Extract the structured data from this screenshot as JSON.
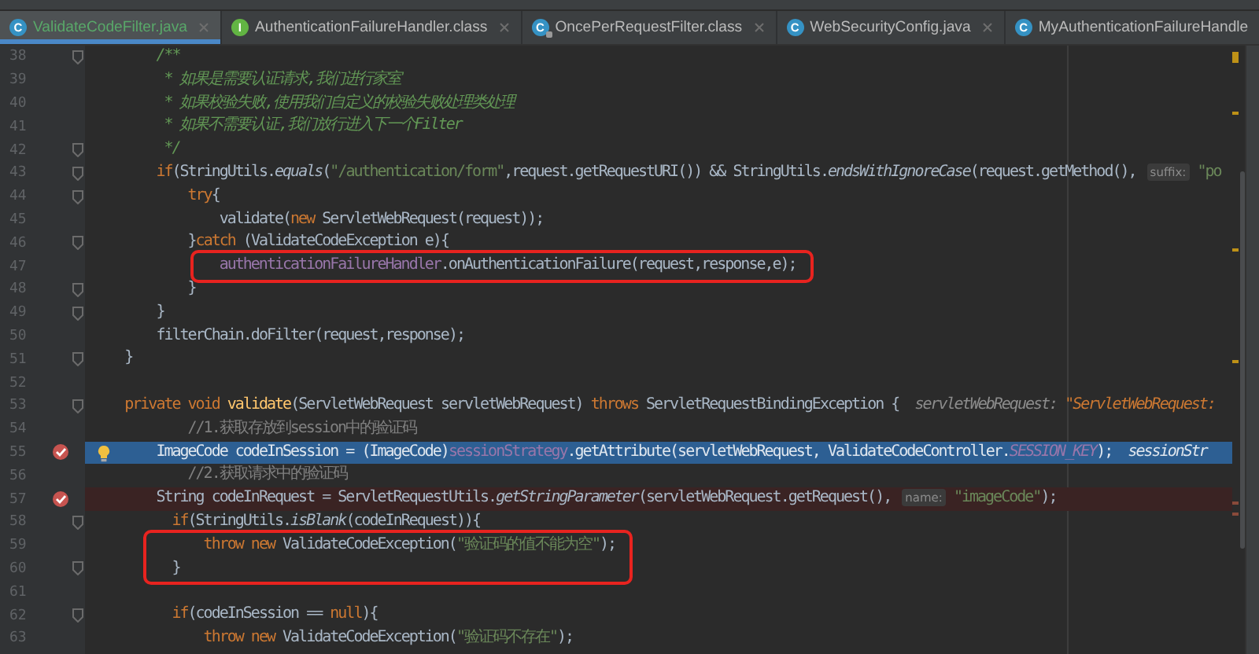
{
  "tabs": [
    {
      "label": "ValidateCodeFilter.java",
      "icon": "C",
      "kind": "class",
      "selected": true,
      "closable": true
    },
    {
      "label": "AuthenticationFailureHandler.class",
      "icon": "I",
      "kind": "interface",
      "selected": false,
      "closable": true
    },
    {
      "label": "OncePerRequestFilter.class",
      "icon": "C",
      "kind": "compiled",
      "selected": false,
      "closable": true
    },
    {
      "label": "WebSecurityConfig.java",
      "icon": "C",
      "kind": "class",
      "selected": false,
      "closable": true
    },
    {
      "label": "MyAuthenticationFailureHandle",
      "icon": "C",
      "kind": "class",
      "selected": false,
      "closable": false
    }
  ],
  "editor": {
    "lines": [
      {
        "number": "38",
        "fold": true,
        "breakpoint": false,
        "boxed": false,
        "tokens": [
          {
            "kind": "doc",
            "text": "        /**"
          }
        ]
      },
      {
        "number": "39",
        "fold": false,
        "breakpoint": false,
        "boxed": false,
        "tokens": [
          {
            "kind": "doc",
            "text": "         * 如果是需要认证请求,我们进行家室"
          }
        ]
      },
      {
        "number": "40",
        "fold": false,
        "breakpoint": false,
        "boxed": false,
        "tokens": [
          {
            "kind": "doc",
            "text": "         * 如果校验失败,使用我们自定义的校验失败处理类处理"
          }
        ]
      },
      {
        "number": "41",
        "fold": false,
        "breakpoint": false,
        "boxed": false,
        "tokens": [
          {
            "kind": "doc",
            "text": "         * 如果不需要认证,我们放行进入下一个Filter"
          }
        ]
      },
      {
        "number": "42",
        "fold": true,
        "breakpoint": false,
        "boxed": false,
        "tokens": [
          {
            "kind": "doc",
            "text": "         */"
          }
        ]
      },
      {
        "number": "43",
        "fold": true,
        "breakpoint": false,
        "boxed": false,
        "tokens": [
          {
            "kind": "kw",
            "text": "        if"
          },
          {
            "kind": "plain",
            "text": "(StringUtils."
          },
          {
            "kind": "static",
            "text": "equals"
          },
          {
            "kind": "plain",
            "text": "("
          },
          {
            "kind": "str",
            "text": "\"/authentication/form\""
          },
          {
            "kind": "plain",
            "text": ",request.getRequestURI()) && StringUtils."
          },
          {
            "kind": "static",
            "text": "endsWithIgnoreCase"
          },
          {
            "kind": "plain",
            "text": "(request.getMethod(), "
          },
          {
            "kind": "hint",
            "text": "suffix:"
          },
          {
            "kind": "str",
            "text": " \"po"
          }
        ]
      },
      {
        "number": "44",
        "fold": true,
        "breakpoint": false,
        "boxed": false,
        "tokens": [
          {
            "kind": "kw",
            "text": "            try"
          },
          {
            "kind": "plain",
            "text": "{"
          }
        ]
      },
      {
        "number": "45",
        "fold": false,
        "breakpoint": false,
        "boxed": false,
        "tokens": [
          {
            "kind": "plain",
            "text": "                validate("
          },
          {
            "kind": "kw",
            "text": "new"
          },
          {
            "kind": "plain",
            "text": " ServletWebRequest(request));"
          }
        ]
      },
      {
        "number": "46",
        "fold": true,
        "breakpoint": false,
        "boxed": false,
        "tokens": [
          {
            "kind": "plain",
            "text": "            }"
          },
          {
            "kind": "kw",
            "text": "catch"
          },
          {
            "kind": "plain",
            "text": " (ValidateCodeException e){"
          }
        ]
      },
      {
        "number": "47",
        "fold": false,
        "breakpoint": false,
        "boxed": true,
        "tokens": [
          {
            "kind": "field",
            "text": "                authenticationFailureHandler"
          },
          {
            "kind": "plain",
            "text": ".onAuthenticationFailure(request,response,e);"
          }
        ]
      },
      {
        "number": "48",
        "fold": true,
        "breakpoint": false,
        "boxed": false,
        "tokens": [
          {
            "kind": "plain",
            "text": "            }"
          }
        ]
      },
      {
        "number": "49",
        "fold": true,
        "breakpoint": false,
        "boxed": false,
        "tokens": [
          {
            "kind": "plain",
            "text": "        }"
          }
        ]
      },
      {
        "number": "50",
        "fold": false,
        "breakpoint": false,
        "boxed": false,
        "tokens": [
          {
            "kind": "plain",
            "text": "        filterChain.doFilter(request,response);"
          }
        ]
      },
      {
        "number": "51",
        "fold": true,
        "breakpoint": false,
        "boxed": false,
        "tokens": [
          {
            "kind": "plain",
            "text": "    }"
          }
        ]
      },
      {
        "number": "52",
        "fold": false,
        "breakpoint": false,
        "boxed": false
      },
      {
        "number": "53",
        "fold": true,
        "breakpoint": false,
        "boxed": false,
        "tokens": [
          {
            "kind": "kw",
            "text": "    private void "
          },
          {
            "kind": "method",
            "text": "validate"
          },
          {
            "kind": "plain",
            "text": "(ServletWebRequest servletWebRequest) "
          },
          {
            "kind": "kw",
            "text": "throws"
          },
          {
            "kind": "plain",
            "text": " ServletRequestBindingException {  "
          },
          {
            "kind": "value",
            "text": "servletWebRequest: "
          },
          {
            "kind": "valuestr",
            "text": "\"ServletWebRequest:"
          }
        ]
      },
      {
        "number": "54",
        "fold": false,
        "breakpoint": false,
        "boxed": false,
        "tokens": [
          {
            "kind": "comment",
            "text": "            //1.获取存放到session中的验证码"
          }
        ]
      },
      {
        "number": "55",
        "fold": false,
        "breakpoint": true,
        "bulb": true,
        "boxed": false,
        "execution_point": true,
        "tokens": [
          {
            "kind": "plain",
            "text": "        ImageCode codeInSession = (ImageCode)"
          },
          {
            "kind": "field",
            "text": "sessionStrategy"
          },
          {
            "kind": "plain",
            "text": ".getAttribute(servletWebRequest, ValidateCodeController."
          },
          {
            "kind": "staticfield",
            "text": "SESSION_KEY"
          },
          {
            "kind": "plain",
            "text": ");  "
          },
          {
            "kind": "value",
            "text": "sessionStr"
          }
        ]
      },
      {
        "number": "56",
        "fold": false,
        "breakpoint": false,
        "boxed": false,
        "tokens": [
          {
            "kind": "comment",
            "text": "            //2.获取请求中的验证码"
          }
        ]
      },
      {
        "number": "57",
        "fold": false,
        "breakpoint": true,
        "boxed": false,
        "execution_point": false,
        "tokens": [
          {
            "kind": "plain",
            "text": "        String codeInRequest = ServletRequestUtils."
          },
          {
            "kind": "static",
            "text": "getStringParameter"
          },
          {
            "kind": "plain",
            "text": "(servletWebRequest.getRequest(), "
          },
          {
            "kind": "hint",
            "text": "name:"
          },
          {
            "kind": "str",
            "text": " \"imageCode\""
          },
          {
            "kind": "plain",
            "text": ");"
          }
        ]
      },
      {
        "number": "58",
        "fold": true,
        "breakpoint": false,
        "boxed": false,
        "tokens": [
          {
            "kind": "kw",
            "text": "          if"
          },
          {
            "kind": "plain",
            "text": "(StringUtils."
          },
          {
            "kind": "static",
            "text": "isBlank"
          },
          {
            "kind": "plain",
            "text": "(codeInRequest)){"
          }
        ]
      },
      {
        "number": "59",
        "fold": false,
        "breakpoint": false,
        "boxed": true,
        "tokens": [
          {
            "kind": "kw",
            "text": "              throw new"
          },
          {
            "kind": "plain",
            "text": " ValidateCodeException("
          },
          {
            "kind": "str",
            "text": "\"验证码的值不能为空\""
          },
          {
            "kind": "plain",
            "text": ");"
          }
        ]
      },
      {
        "number": "60",
        "fold": true,
        "breakpoint": false,
        "boxed": true,
        "tokens": [
          {
            "kind": "plain",
            "text": "          }"
          }
        ]
      },
      {
        "number": "61",
        "fold": false,
        "breakpoint": false,
        "boxed": false
      },
      {
        "number": "62",
        "fold": true,
        "breakpoint": false,
        "boxed": false,
        "tokens": [
          {
            "kind": "kw",
            "text": "          if"
          },
          {
            "kind": "plain",
            "text": "(codeInSession == "
          },
          {
            "kind": "kw",
            "text": "null"
          },
          {
            "kind": "plain",
            "text": "){"
          }
        ]
      },
      {
        "number": "63",
        "fold": false,
        "breakpoint": false,
        "boxed": false,
        "tokens": [
          {
            "kind": "kw",
            "text": "              throw new"
          },
          {
            "kind": "plain",
            "text": " ValidateCodeException("
          },
          {
            "kind": "str",
            "text": "\"验证码不存在\""
          },
          {
            "kind": "plain",
            "text": ");"
          }
        ]
      }
    ]
  }
}
